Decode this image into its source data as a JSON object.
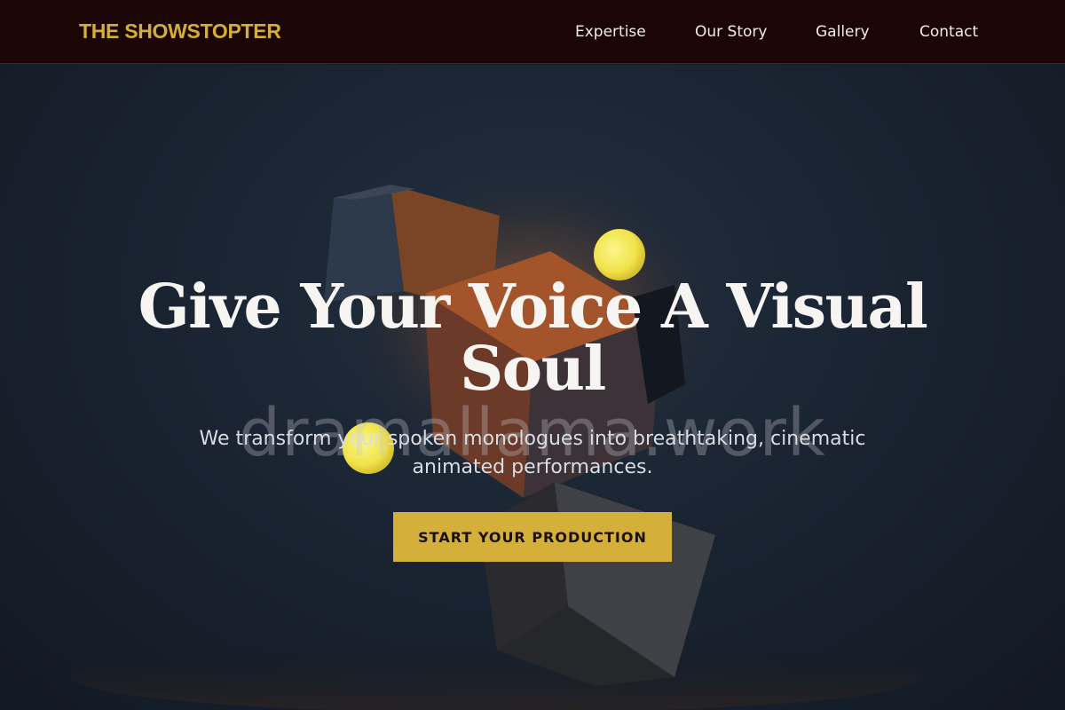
{
  "header": {
    "brand": "THE SHOWSTOPTER",
    "nav": [
      {
        "label": "Expertise"
      },
      {
        "label": "Our Story"
      },
      {
        "label": "Gallery"
      },
      {
        "label": "Contact"
      }
    ]
  },
  "hero": {
    "title": "Give Your Voice A Visual Soul",
    "subtitle": "We transform your spoken monologues into breathtaking, cinematic animated performances.",
    "cta_label": "START YOUR PRODUCTION",
    "watermark": "dramallama.work"
  },
  "colors": {
    "header_bg": "#1b0505",
    "brand": "#d4af37",
    "accent_button": "#d4b03a",
    "hero_bg": "#1a2432",
    "sphere": "#f4ea5a"
  }
}
